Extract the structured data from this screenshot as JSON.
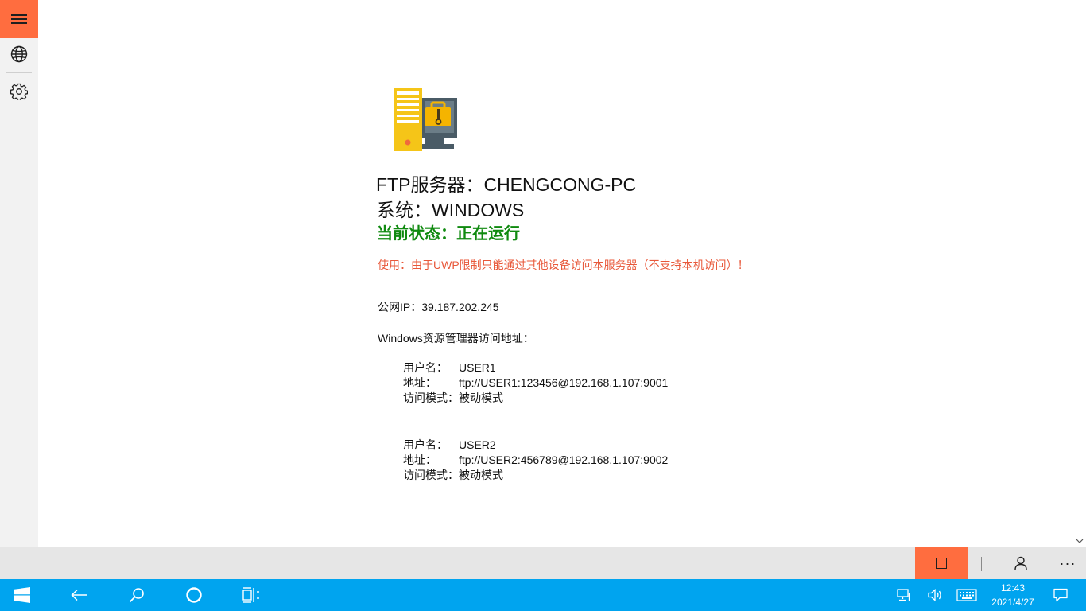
{
  "server": {
    "label": "FTP服务器：",
    "name": "CHENGCONG-PC"
  },
  "system": {
    "label": "系统：",
    "value": "WINDOWS"
  },
  "status": {
    "text": "当前状态：正在运行",
    "color": "#108a10"
  },
  "notice": {
    "text": "使用：由于UWP限制只能通过其他设备访问本服务器（不支持本机访问）！",
    "color": "#e8583a"
  },
  "public_ip": {
    "label": "公网IP：",
    "value": "39.187.202.245"
  },
  "explorer_heading": "Windows资源管理器访问地址：",
  "accounts": [
    {
      "username_label": "用户名：",
      "username": "USER1",
      "address_label": "地址：",
      "address": "ftp://USER1:123456@192.168.1.107:9001",
      "mode_label": "访问模式：",
      "mode": "被动模式"
    },
    {
      "username_label": "用户名：",
      "username": "USER2",
      "address_label": "地址：",
      "address": "ftp://USER2:456789@192.168.1.107:9002",
      "mode_label": "访问模式：",
      "mode": "被动模式"
    }
  ],
  "nav": {
    "items": [
      "hamburger-menu-icon",
      "globe-icon",
      "gear-icon"
    ]
  },
  "command_bar": {
    "more": "···"
  },
  "taskbar": {
    "time": "12:43",
    "date": "2021/4/27"
  },
  "colors": {
    "accent": "#ff6d3f",
    "taskbar": "#00a4ef"
  }
}
